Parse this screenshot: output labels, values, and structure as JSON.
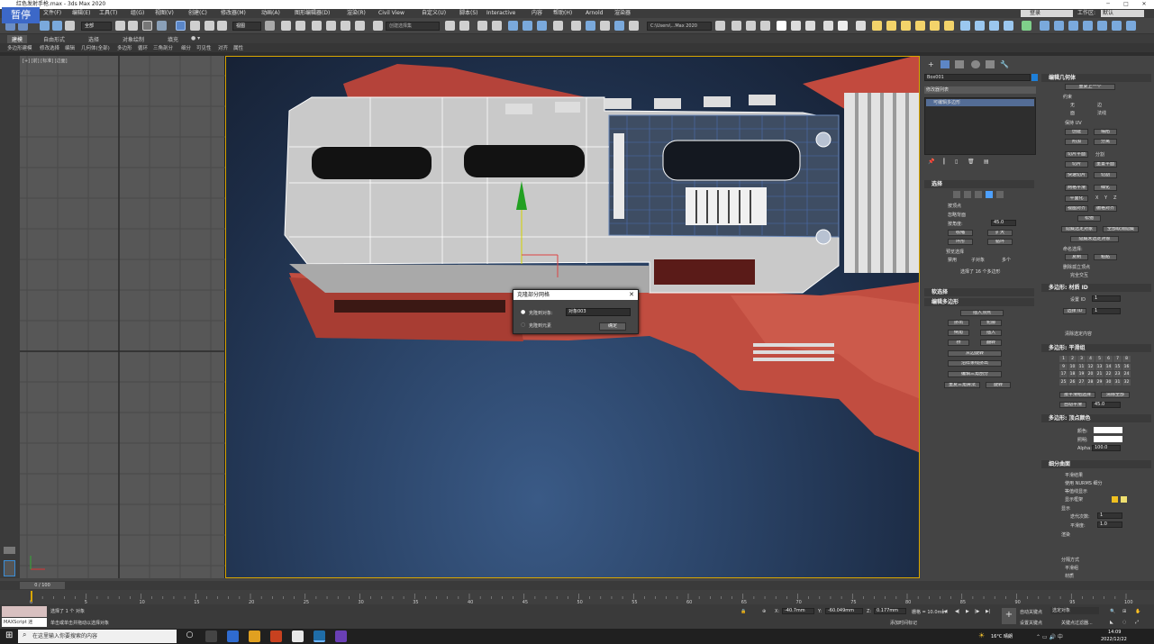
{
  "window": {
    "title": "红色发射手枪.max - 3ds Max 2020",
    "pause_badge": "暂停"
  },
  "menu": {
    "items": [
      "文件(F)",
      "编辑(E)",
      "工具(T)",
      "组(G)",
      "视图(V)",
      "创建(C)",
      "修改器(M)",
      "动画(A)",
      "图形编辑器(D)",
      "渲染(R)",
      "Civil View",
      "自定义(U)",
      "脚本(S)",
      "Interactive",
      "内容",
      "帮助(H)",
      "Arnold",
      "渲染器"
    ],
    "user": "登录",
    "workspace_label": "工作区:",
    "workspace_value": "默认"
  },
  "toolbar": {
    "filter_value": "全部",
    "view_value": "视图",
    "selection_set": "创建选择集",
    "path_value": "C:\\Users\\...Max 2020"
  },
  "ribbon": {
    "tabs": [
      "建模",
      "自由形式",
      "选择",
      "对象绘制",
      "填充"
    ],
    "tools": [
      "多边形建模",
      "修改选择",
      "编辑",
      "几何体(全部)",
      "多边形",
      "循环",
      "三角剖分",
      "细分",
      "可见性",
      "对齐",
      "属性"
    ]
  },
  "viewport_left": {
    "label": "[+] [前] [标准] [边面]"
  },
  "dialog": {
    "title": "克隆部分网格",
    "option1": "克隆到对象:",
    "option1_value": "对象003",
    "option2": "克隆到元素",
    "ok": "确定"
  },
  "command_panel": {
    "object_name": "Box001",
    "modifier_list": "修改器列表",
    "stack_item": "可编辑多边形",
    "selection_rollout": "选择",
    "selection_items": [
      "按顶点",
      "忽略背面",
      "按角度:",
      "45.0",
      "收缩",
      "扩大",
      "环形",
      "循环"
    ],
    "preview_selection": "预览选择",
    "preview_options": [
      "禁用",
      "子对象",
      "多个"
    ],
    "selection_status": "选择了 16 个多边形",
    "soft_selection": "软选择",
    "edit_polygons": "编辑多边形",
    "edit_poly_buttons": [
      "插入顶点",
      "挤出",
      "轮廓",
      "倒角",
      "插入",
      "桥",
      "翻转",
      "从边旋转",
      "沿样条线挤出",
      "编辑三角剖分",
      "重复三角算法",
      "旋转"
    ]
  },
  "command_panel2": {
    "edit_geometry": "编辑几何体",
    "repeat_last": "重复上一个",
    "constraints_label": "约束",
    "constraints": [
      "无",
      "边",
      "面",
      "法线"
    ],
    "preserve_uv": "保持 UV",
    "geom_buttons": [
      "创建",
      "塌陷",
      "附加",
      "分离",
      "切片平面",
      "分割",
      "切片",
      "重置平面",
      "快速切片",
      "切割",
      "网格平滑",
      "细化",
      "平面化",
      "X",
      "Y",
      "Z",
      "视图对齐",
      "栅格对齐",
      "松弛"
    ],
    "hide_buttons": [
      "隐藏选定对象",
      "全部取消隐藏",
      "隐藏未选定对象"
    ],
    "named_sel": "命名选择:",
    "copy": "复制",
    "paste": "粘贴",
    "delete_iso": "删除孤立顶点",
    "full_interactivity": "完全交互",
    "material_id": "多边形: 材质 ID",
    "set_id": "设置 ID",
    "set_id_value": "1",
    "select_id": "选择 ID",
    "select_id_value": "1",
    "clear_selection": "清除选定内容",
    "smoothing_groups": "多边形: 平滑组",
    "sg_numbers": [
      "1",
      "2",
      "3",
      "4",
      "5",
      "6",
      "7",
      "8",
      "9",
      "10",
      "11",
      "12",
      "13",
      "14",
      "15",
      "16",
      "17",
      "18",
      "19",
      "20",
      "21",
      "22",
      "23",
      "24",
      "25",
      "26",
      "27",
      "28",
      "29",
      "30",
      "31",
      "32"
    ],
    "select_by_sg": "按平滑组选择",
    "clear_all": "清除全部",
    "auto_smooth": "自动平滑",
    "auto_smooth_value": "45.0",
    "vertex_colors": "多边形: 顶点颜色",
    "color_label": "颜色:",
    "illum_label": "照明:",
    "alpha_label": "Alpha:",
    "alpha_value": "100.0",
    "subdivision": "细分曲面",
    "sub_options": [
      "平滑结果",
      "使用 NURMS 细分",
      "等值线显示",
      "显示框架"
    ],
    "display_label": "显示",
    "iterations_label": "迭代次数:",
    "iterations_value": "1",
    "smoothness_label": "平滑度:",
    "smoothness_value": "1.0",
    "render_label": "渲染",
    "separate_label": "分隔方式",
    "separate_options": [
      "平滑组",
      "材质"
    ]
  },
  "timeline": {
    "frame": "0 / 100",
    "ticks": [
      "0",
      "5",
      "10",
      "15",
      "20",
      "25",
      "30",
      "35",
      "40",
      "45",
      "50",
      "55",
      "60",
      "65",
      "70",
      "75",
      "80",
      "85",
      "90",
      "95",
      "100"
    ]
  },
  "status": {
    "selected": "选择了 1 个 对象",
    "hint": "单击或单击并拖动以选择对象",
    "script_label": "MAXScript 迷",
    "x_label": "X:",
    "x": "-40.7mm",
    "y_label": "Y:",
    "y": "-60.049mm",
    "z_label": "Z:",
    "z": "0.177mm",
    "grid": "栅格 = 10.0mm",
    "add_time_tag": "添加时间标记",
    "auto_key": "自动关键点",
    "set_key": "设置关键点",
    "selected_obj": "选定对象",
    "key_filters": "关键点过滤器..."
  },
  "taskbar": {
    "search_placeholder": "在这里输入你要搜索的内容",
    "weather": "16°C 晴朗",
    "time": "14:09",
    "date": "2022/12/22"
  }
}
